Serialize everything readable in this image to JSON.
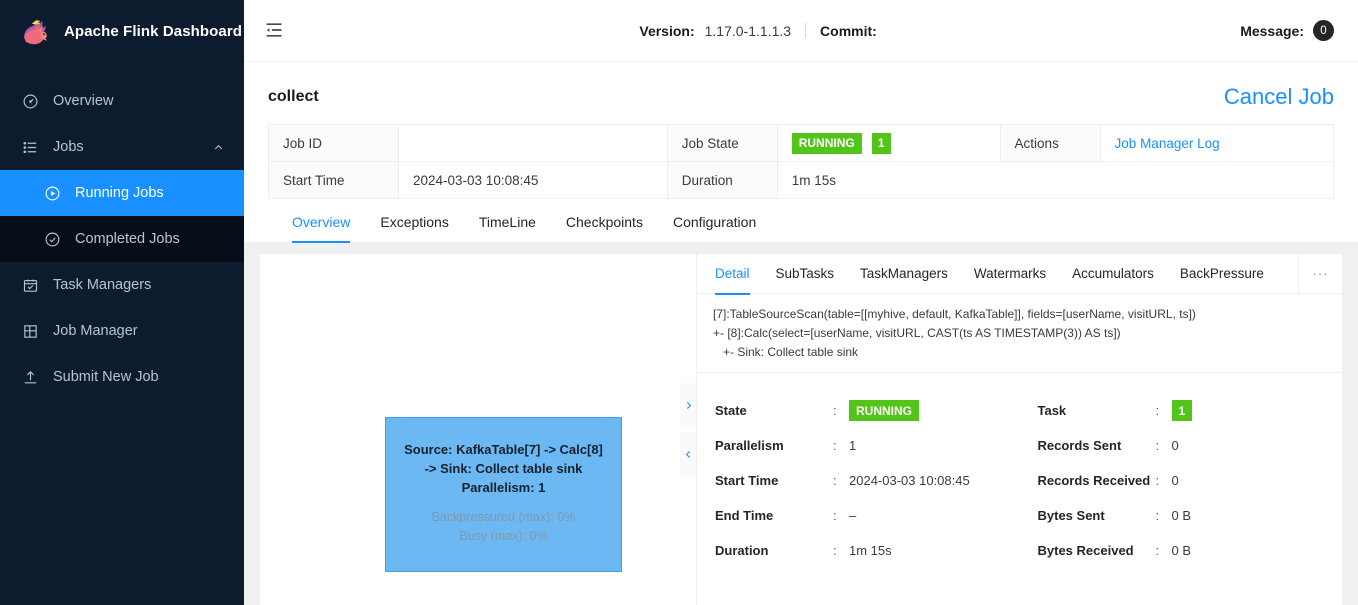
{
  "sidebar": {
    "brand_title": "Apache Flink Dashboard",
    "items": [
      {
        "label": "Overview",
        "icon": "dashboard-icon",
        "level": "top",
        "active": false
      },
      {
        "label": "Jobs",
        "icon": "list-icon",
        "level": "top",
        "active": false,
        "expanded": true
      },
      {
        "label": "Running Jobs",
        "icon": "play-circle-icon",
        "level": "sub",
        "active": true
      },
      {
        "label": "Completed Jobs",
        "icon": "check-circle-icon",
        "level": "sub",
        "active": false
      },
      {
        "label": "Task Managers",
        "icon": "calendar-check-icon",
        "level": "top",
        "active": false
      },
      {
        "label": "Job Manager",
        "icon": "build-grid-icon",
        "level": "top",
        "active": false
      },
      {
        "label": "Submit New Job",
        "icon": "upload-icon",
        "level": "top",
        "active": false
      }
    ]
  },
  "topbar": {
    "fold_icon": "menu-unfold-icon",
    "version_label": "Version:",
    "version_value": "1.17.0-1.1.1.3",
    "commit_label": "Commit:",
    "commit_value": "",
    "message_label": "Message:",
    "message_count": "0"
  },
  "job": {
    "name": "collect",
    "cancel_label": "Cancel Job",
    "rows": [
      {
        "k1": "Job ID",
        "v1": "",
        "k2": "Job State",
        "v2_badge": "RUNNING",
        "v2_num": "1",
        "k3": "Actions",
        "v3_link": "Job Manager Log"
      },
      {
        "k1": "Start Time",
        "v1": "2024-03-03 10:08:45",
        "k2": "Duration",
        "v2": "1m 15s",
        "k3": "",
        "v3": ""
      }
    ]
  },
  "main_tabs": [
    {
      "label": "Overview",
      "active": true
    },
    {
      "label": "Exceptions",
      "active": false
    },
    {
      "label": "TimeLine",
      "active": false
    },
    {
      "label": "Checkpoints",
      "active": false
    },
    {
      "label": "Configuration",
      "active": false
    }
  ],
  "graph": {
    "node": {
      "title_line1": "Source: KafkaTable[7] -> Calc[8]",
      "title_line2": "-> Sink: Collect table sink",
      "title_line3": "Parallelism: 1",
      "sub_line1": "Backpressured (max): 0%",
      "sub_line2": "Busy (max): 0%",
      "color": "#6cb8f2"
    },
    "collapse_right_icon": "chevron-right-icon",
    "collapse_left_icon": "chevron-left-icon"
  },
  "detail_tabs": [
    {
      "label": "Detail",
      "active": true
    },
    {
      "label": "SubTasks",
      "active": false
    },
    {
      "label": "TaskManagers",
      "active": false
    },
    {
      "label": "Watermarks",
      "active": false
    },
    {
      "label": "Accumulators",
      "active": false
    },
    {
      "label": "BackPressure",
      "active": false
    }
  ],
  "detail_more_label": "···",
  "detail": {
    "plan_text": "[7]:TableSourceScan(table=[[myhive, default, KafkaTable]], fields=[userName, visitURL, ts])\n+- [8]:Calc(select=[userName, visitURL, CAST(ts AS TIMESTAMP(3)) AS ts])\n   +- Sink: Collect table sink",
    "left_fields": [
      {
        "key": "State",
        "value": "RUNNING",
        "type": "badge"
      },
      {
        "key": "Parallelism",
        "value": "1",
        "type": "text"
      },
      {
        "key": "Start Time",
        "value": "2024-03-03 10:08:45",
        "type": "text"
      },
      {
        "key": "End Time",
        "value": "–",
        "type": "text"
      },
      {
        "key": "Duration",
        "value": "1m 15s",
        "type": "text"
      }
    ],
    "right_fields": [
      {
        "key": "Task",
        "value": "1",
        "type": "badge-num"
      },
      {
        "key": "Records Sent",
        "value": "0",
        "type": "text"
      },
      {
        "key": "Records Received",
        "value": "0",
        "type": "text"
      },
      {
        "key": "Bytes Sent",
        "value": "0 B",
        "type": "text"
      },
      {
        "key": "Bytes Received",
        "value": "0 B",
        "type": "text"
      }
    ],
    "separator": ":"
  },
  "colors": {
    "sidebar_bg": "#0d1b2e",
    "accent_blue": "#1890ff",
    "status_green": "#52c41a",
    "node_blue": "#6cb8f2"
  }
}
